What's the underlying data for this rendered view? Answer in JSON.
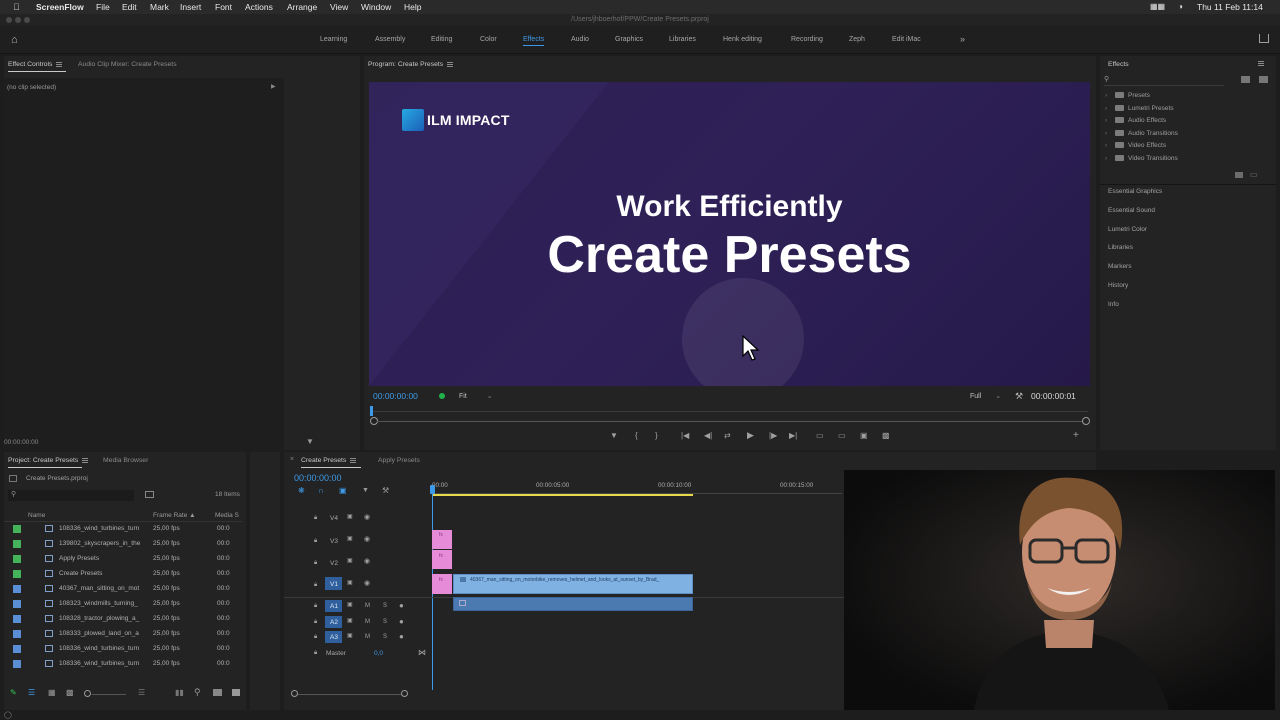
{
  "mac_menubar": {
    "app": "ScreenFlow",
    "items": [
      "File",
      "Edit",
      "Mark",
      "Insert",
      "Font",
      "Actions",
      "Arrange",
      "View",
      "Window",
      "Help"
    ],
    "clock": "Thu 11 Feb  11:14"
  },
  "app_titlebar": {
    "path": "/Users/jhboerhof/PPW/Create Presets.prproj"
  },
  "workspaces": {
    "tabs": [
      "Learning",
      "Assembly",
      "Editing",
      "Color",
      "Effects",
      "Audio",
      "Graphics",
      "Libraries",
      "Henk editing",
      "Recording",
      "Zeph",
      "Edit iMac"
    ],
    "active": "Effects",
    "more": "»"
  },
  "effect_controls": {
    "tab1": "Effect Controls",
    "tab2": "Audio Clip Mixer: Create Presets",
    "no_clip": "(no clip selected)",
    "timecode": "00:00:00:00"
  },
  "program_monitor": {
    "title": "Program: Create Presets",
    "logo_text": "ILM IMPACT",
    "heading1": "Work Efficiently",
    "heading2": "Create Presets",
    "timecode_in": "00:00:00:00",
    "fit": "Fit",
    "resolution": "Full",
    "timecode_out": "00:00:00:01"
  },
  "effects_panel": {
    "title": "Effects",
    "folders": [
      "Presets",
      "Lumetri Presets",
      "Audio Effects",
      "Audio Transitions",
      "Video Effects",
      "Video Transitions"
    ],
    "sections": [
      "Essential Graphics",
      "Essential Sound",
      "Lumetri Color",
      "Libraries",
      "Markers",
      "History",
      "Info"
    ]
  },
  "project_panel": {
    "tab1": "Project: Create Presets",
    "tab2": "Media Browser",
    "file": "Create Presets.prproj",
    "items_count": "18 Items",
    "columns": {
      "name": "Name",
      "frame_rate": "Frame Rate",
      "media": "Media S"
    },
    "rows": [
      {
        "name": "108336_wind_turbines_turn",
        "fps": "25,00 fps",
        "media": "00:0",
        "color": "#45b35a"
      },
      {
        "name": "139802_skyscrapers_in_the",
        "fps": "25,00 fps",
        "media": "00:0",
        "color": "#45b35a"
      },
      {
        "name": "Apply Presets",
        "fps": "25,00 fps",
        "media": "00:0",
        "color": "#45b35a"
      },
      {
        "name": "Create Presets",
        "fps": "25,00 fps",
        "media": "00:0",
        "color": "#45b35a"
      },
      {
        "name": "40367_man_sitting_on_mot",
        "fps": "25,00 fps",
        "media": "00:0",
        "color": "#5a8fd6"
      },
      {
        "name": "108323_windmills_turning_",
        "fps": "25,00 fps",
        "media": "00:0",
        "color": "#5a8fd6"
      },
      {
        "name": "108328_tractor_plowing_a_",
        "fps": "25,00 fps",
        "media": "00:0",
        "color": "#5a8fd6"
      },
      {
        "name": "108333_plowed_land_on_a",
        "fps": "25,00 fps",
        "media": "00:0",
        "color": "#5a8fd6"
      },
      {
        "name": "108336_wind_turbines_turn",
        "fps": "25,00 fps",
        "media": "00:0",
        "color": "#5a8fd6"
      },
      {
        "name": "108336_wind_turbines_turn",
        "fps": "25,00 fps",
        "media": "00:0",
        "color": "#5a8fd6"
      }
    ]
  },
  "timeline": {
    "tab1": "Create Presets",
    "tab2": "Apply Presets",
    "timecode": "00:00:00:00",
    "ruler": [
      "00:00",
      "00:00:05:00",
      "00:00:10:00",
      "00:00:15:00"
    ],
    "video_tracks": [
      "V4",
      "V3",
      "V2",
      "V1"
    ],
    "audio_tracks": [
      "A1",
      "A2",
      "A3"
    ],
    "master": "Master",
    "master_value": "0,0",
    "clip_label": "40367_man_sitting_on_motorbike_removes_helmet_and_looks_at_sunset_by_Brad_"
  },
  "colors": {
    "accent": "#3d9ae8",
    "pink_clip": "#e58bd8",
    "blue_clip": "#7fb1e3"
  }
}
